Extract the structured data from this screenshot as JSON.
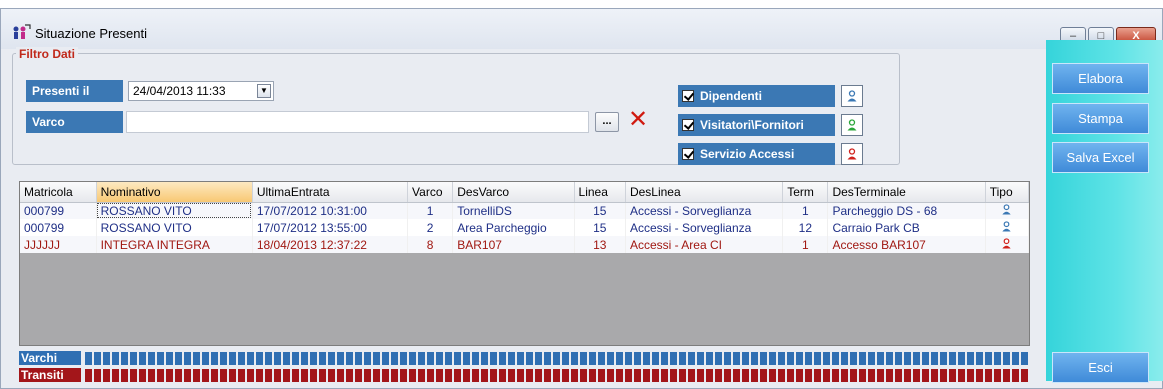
{
  "window": {
    "title": "Situazione Presenti",
    "close_label": "X",
    "minimize_label": "–",
    "maximize_label": "□"
  },
  "filter": {
    "legend": "Filtro Dati",
    "presenti_label": "Presenti il",
    "presenti_value": "24/04/2013 11:33",
    "varco_label": "Varco",
    "varco_value": "",
    "browse_label": "...",
    "clear_label": "✕",
    "checks": [
      {
        "label": "Dipendenti",
        "checked": true,
        "person_color": "#3b78b4"
      },
      {
        "label": "Visitatori\\Fornitori",
        "checked": true,
        "person_color": "#2aa63a"
      },
      {
        "label": "Servizio Accessi",
        "checked": true,
        "person_color": "#d0211c"
      }
    ]
  },
  "grid": {
    "columns": [
      "Matricola",
      "Nominativo",
      "UltimaEntrata",
      "Varco",
      "DesVarco",
      "Linea",
      "DesLinea",
      "Term",
      "DesTerminale",
      "Tipo"
    ],
    "sorted_column": "Nominativo",
    "rows": [
      {
        "matricola": "000799",
        "nominativo": "ROSSANO VITO",
        "ultima": "17/07/2012 10:31:00",
        "varco": "1",
        "desvarco": "TornelliDS",
        "linea": "15",
        "deslinea": "Accessi - Sorveglianza",
        "term": "1",
        "desterm": "Parcheggio DS - 68",
        "color": "#1f2f86",
        "tipo_color": "#3b78b4"
      },
      {
        "matricola": "000799",
        "nominativo": "ROSSANO VITO",
        "ultima": "17/07/2012 13:55:00",
        "varco": "2",
        "desvarco": "Area Parcheggio",
        "linea": "15",
        "deslinea": "Accessi - Sorveglianza",
        "term": "12",
        "desterm": "Carraio Park CB",
        "color": "#1f2f86",
        "tipo_color": "#3b78b4"
      },
      {
        "matricola": "JJJJJJ",
        "nominativo": "INTEGRA INTEGRA",
        "ultima": "18/04/2013 12:37:22",
        "varco": "8",
        "desvarco": "BAR107",
        "linea": "13",
        "deslinea": "Accessi - Area CI",
        "term": "1",
        "desterm": "Accesso BAR107",
        "color": "#a01812",
        "tipo_color": "#d0211c"
      }
    ]
  },
  "status": {
    "varchi_label": "Varchi",
    "transiti_label": "Transiti",
    "varchi_color": "#2f6fb3",
    "transiti_color": "#a3161a"
  },
  "actions": {
    "elabora": "Elabora",
    "stampa": "Stampa",
    "salva_excel": "Salva Excel",
    "esci": "Esci"
  }
}
